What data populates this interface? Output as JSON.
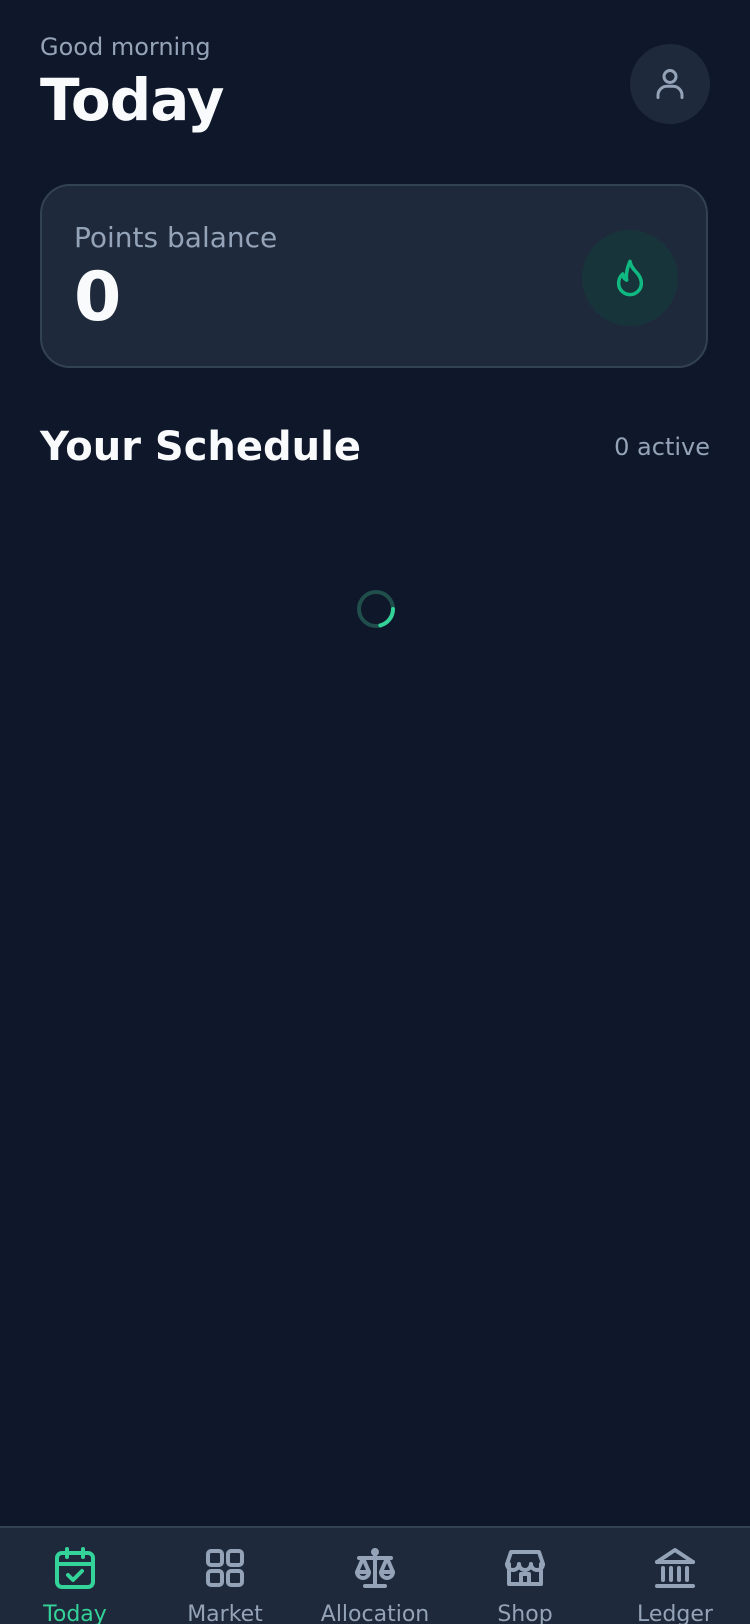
{
  "header": {
    "greeting": "Good morning",
    "title": "Today",
    "avatar_icon": "user-icon"
  },
  "points": {
    "label": "Points balance",
    "value": "0",
    "icon": "flame-icon"
  },
  "schedule": {
    "title": "Your Schedule",
    "active_count": "0 active",
    "loading": true
  },
  "tabs": [
    {
      "label": "Today",
      "icon": "calendar-check-icon",
      "active": true
    },
    {
      "label": "Market",
      "icon": "grid-icon",
      "active": false
    },
    {
      "label": "Allocation",
      "icon": "scale-icon",
      "active": false
    },
    {
      "label": "Shop",
      "icon": "store-icon",
      "active": false
    },
    {
      "label": "Ledger",
      "icon": "bank-icon",
      "active": false
    }
  ],
  "colors": {
    "background": "#0f172a",
    "card": "#1e293b",
    "accent": "#34d399",
    "muted_text": "#94a3b8"
  }
}
